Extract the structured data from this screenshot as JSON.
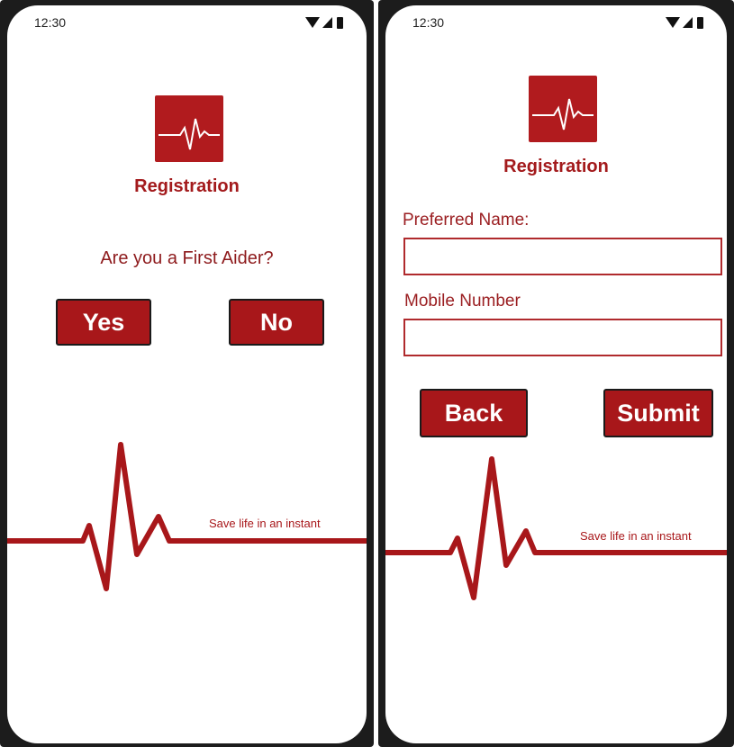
{
  "colors": {
    "brand_red": "#a8171a",
    "text_red": "#8e1b1d",
    "frame": "#1c1c1c"
  },
  "screen_left": {
    "status_bar": {
      "time": "12:30",
      "icons": [
        "wifi-icon",
        "signal-icon",
        "battery-icon"
      ]
    },
    "logo_icon": "heartbeat-logo-icon",
    "title": "Registration",
    "question": "Are you a First Aider?",
    "buttons": {
      "yes_label": "Yes",
      "no_label": "No"
    },
    "tagline": "Save life in an instant"
  },
  "screen_right": {
    "status_bar": {
      "time": "12:30",
      "icons": [
        "wifi-icon",
        "signal-icon",
        "battery-icon"
      ]
    },
    "logo_icon": "heartbeat-logo-icon",
    "title": "Registration",
    "form": {
      "name_label": "Preferred Name:",
      "name_value": "",
      "mobile_label": "Mobile Number",
      "mobile_value": ""
    },
    "buttons": {
      "back_label": "Back",
      "submit_label": "Submit"
    },
    "tagline": "Save life in an instant"
  }
}
